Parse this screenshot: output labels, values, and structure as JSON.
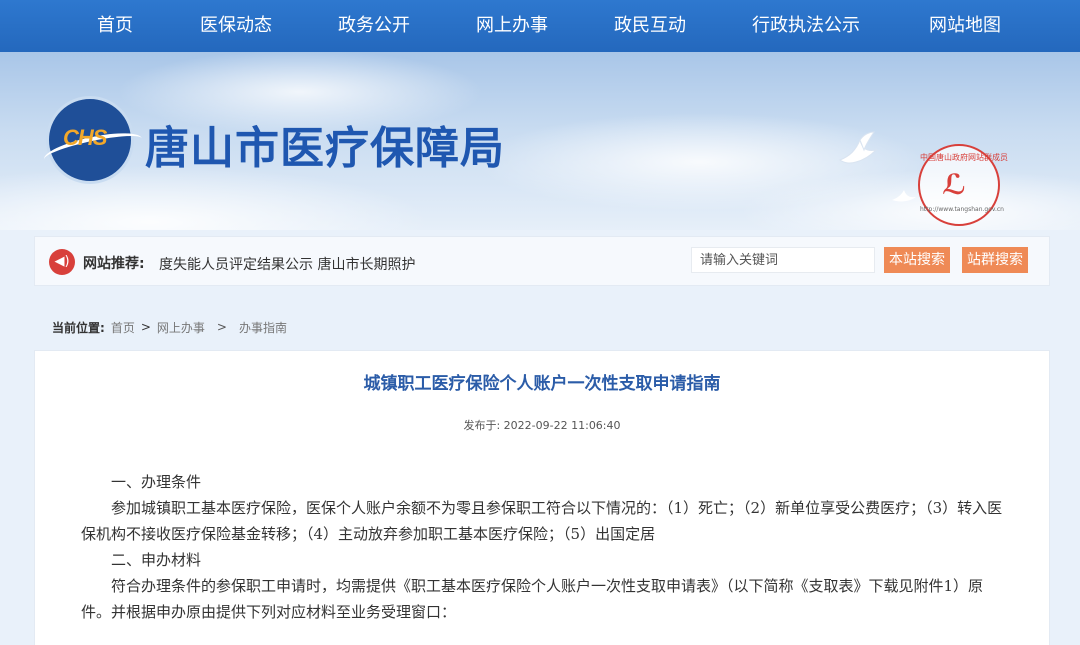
{
  "nav": {
    "items": [
      "首页",
      "医保动态",
      "政务公开",
      "网上办事",
      "政民互动",
      "行政执法公示",
      "网站地图"
    ]
  },
  "header": {
    "logo_text": "CHS",
    "site_title": "唐山市医疗保障局",
    "seal_text": "中国唐山政府网站群成员",
    "seal_url": "http://www.tangshan.gov.cn"
  },
  "recommend": {
    "label": "网站推荐:",
    "scroll_text": "度失能人员评定结果公示 唐山市长期照护",
    "search_placeholder": "请输入关键词",
    "search_site_button": "本站搜索",
    "search_group_button": "站群搜索"
  },
  "breadcrumb": {
    "label": "当前位置:",
    "items": [
      "首页",
      "网上办事",
      "办事指南"
    ]
  },
  "article": {
    "title": "城镇职工医疗保险个人账户一次性支取申请指南",
    "meta": "发布于: 2022-09-22 11:06:40",
    "paragraphs": [
      "一、办理条件",
      "参加城镇职工基本医疗保险，医保个人账户余额不为零且参保职工符合以下情况的：（1）死亡；（2）新单位享受公费医疗；（3）转入医保机构不接收医疗保险基金转移；（4）主动放弃参加职工基本医疗保险；（5）出国定居",
      "二、申办材料",
      "符合办理条件的参保职工申请时，均需提供《职工基本医疗保险个人账户一次性支取申请表》（以下简称《支取表》下载见附件1）原件。并根据申办原由提供下列对应材料至业务受理窗口："
    ]
  },
  "colors": {
    "nav_bg": "#2a70c6",
    "title_blue": "#1f57b0",
    "button_orange": "#ef8a56",
    "article_title": "#2b5ca8"
  }
}
